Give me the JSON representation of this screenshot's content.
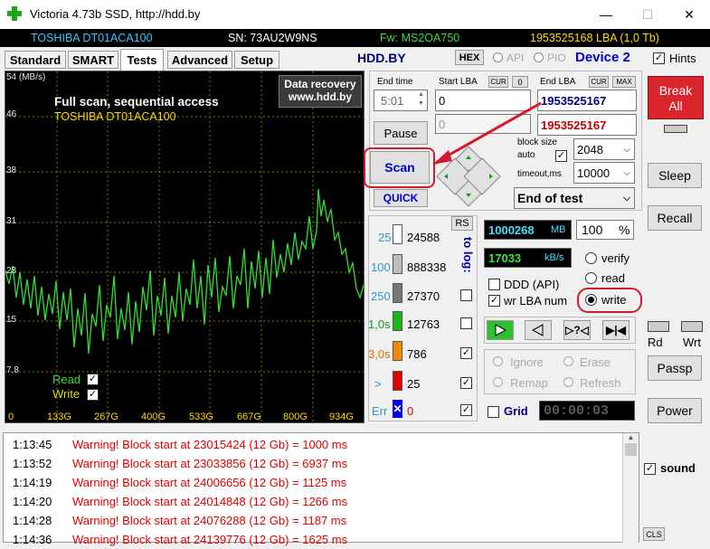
{
  "window": {
    "title": "Victoria 4.73b SSD, http://hdd.by",
    "minimize": "—",
    "maximize": "☐",
    "close": "✕"
  },
  "infobar": {
    "model": "TOSHIBA DT01ACA100",
    "serial": "SN: 73AU2W9NS",
    "firmware": "Fw: MS2OA750",
    "capacity": "1953525168 LBA (1,0 Tb)"
  },
  "tabs": [
    "Standard",
    "SMART",
    "Tests",
    "Advanced",
    "Setup"
  ],
  "topbar": {
    "site": "HDD.BY",
    "hex": "HEX",
    "api": "API",
    "pio": "PIO",
    "device": "Device 2",
    "hints": "Hints"
  },
  "graph": {
    "ylabels": [
      "54 (MB/s)",
      "46",
      "38",
      "31",
      "23",
      "15",
      "7,8"
    ],
    "xlabels": [
      "0",
      "133G",
      "267G",
      "400G",
      "533G",
      "667G",
      "800G",
      "934G"
    ],
    "title": "Full scan, sequential access",
    "drive": "TOSHIBA DT01ACA100",
    "promo1": "Data recovery",
    "promo2": "www.hdd.by",
    "read": "Read",
    "write": "Write"
  },
  "controls": {
    "end_time_label": "End time",
    "end_time": "5:01",
    "start_lba_label": "Start LBA",
    "cur": "CUR",
    "start_lba": "0",
    "end_lba_label": "End LBA",
    "max": "MAX",
    "end_lba": "1953525167",
    "end_lba2": "1953525167",
    "start_lba2": "0",
    "pause": "Pause",
    "scan": "Scan",
    "quick": "QUICK",
    "block_size_label": "block size",
    "auto_label": "auto",
    "block_size": "2048",
    "timeout_label": "timeout,ms",
    "timeout": "10000",
    "end_mode": "End of test"
  },
  "stats": {
    "rs": "RS",
    "to_log": "to log:",
    "rows": [
      {
        "label": "25",
        "count": "24588"
      },
      {
        "label": "100",
        "count": "888338"
      },
      {
        "label": "250",
        "count": "27370"
      },
      {
        "label": "1,0s",
        "count": "12763"
      },
      {
        "label": "3,0s",
        "count": "786"
      },
      {
        "label": ">",
        "count": "25"
      },
      {
        "label": "Err",
        "count": "0"
      }
    ]
  },
  "progress": {
    "mb": "1000268",
    "mb_unit": "MB",
    "pct": "100",
    "pct_unit": "%",
    "speed": "17033",
    "speed_unit": "kB/s",
    "verify": "verify",
    "read": "read",
    "write": "write",
    "ddd": "DDD (API)",
    "wrlba": "wr LBA num",
    "ignore": "Ignore",
    "erase": "Erase",
    "remap": "Remap",
    "refresh": "Refresh",
    "grid": "Grid",
    "timer": "00:00:03"
  },
  "side": {
    "break_all": "Break\nAll",
    "sleep": "Sleep",
    "recall": "Recall",
    "rd": "Rd",
    "wrt": "Wrt",
    "passp": "Passp",
    "power": "Power",
    "sound": "sound",
    "cls": "CLS"
  },
  "log": [
    {
      "time": "1:13:45",
      "msg": "Warning! Block start at 23015424 (12 Gb)  = 1000 ms"
    },
    {
      "time": "1:13:52",
      "msg": "Warning! Block start at 23033856 (12 Gb)  = 6937 ms"
    },
    {
      "time": "1:14:19",
      "msg": "Warning! Block start at 24006656 (12 Gb)  = 1125 ms"
    },
    {
      "time": "1:14:20",
      "msg": "Warning! Block start at 24014848 (12 Gb)  = 1266 ms"
    },
    {
      "time": "1:14:28",
      "msg": "Warning! Block start at 24076288 (12 Gb)  = 1187 ms"
    },
    {
      "time": "1:14:36",
      "msg": "Warning! Block start at 24139776 (12 Gb)  = 1625 ms"
    }
  ],
  "colors": {
    "graph_green": "#33dd33",
    "accent_blue": "#0000cc",
    "break_red": "#d9262c",
    "log_red": "#e00000"
  }
}
